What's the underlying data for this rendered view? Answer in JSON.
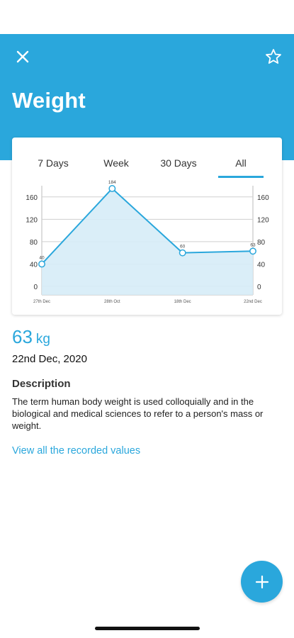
{
  "header": {
    "title": "Weight",
    "close_icon": "close-icon",
    "favorite_icon": "star-outline-icon"
  },
  "tabs": [
    {
      "label": "7 Days",
      "selected": false
    },
    {
      "label": "Week",
      "selected": false
    },
    {
      "label": "30 Days",
      "selected": false
    },
    {
      "label": "All",
      "selected": true
    }
  ],
  "chart_data": {
    "type": "area",
    "x": [
      "27th Dec",
      "28th Oct",
      "18th Dec",
      "22nd Dec"
    ],
    "y": [
      40,
      175,
      60,
      63
    ],
    "data_labels": [
      "40",
      "184",
      "60",
      "63"
    ],
    "yticks_left": [
      0,
      40,
      80,
      120,
      160
    ],
    "yticks_right": [
      0,
      40,
      80,
      120,
      160
    ],
    "ylim": [
      0,
      180
    ],
    "grid": true,
    "colors": {
      "line": "#2aa7dc",
      "fill": "#d6ecf7"
    }
  },
  "latest": {
    "value": "63",
    "unit": "kg",
    "date": "22nd Dec, 2020"
  },
  "description": {
    "title": "Description",
    "text": "The term human body weight is used colloquially and in the biological and medical sciences to refer to a person's mass or weight."
  },
  "link": {
    "label": "View all the recorded values"
  },
  "fab": {
    "icon": "plus-icon"
  },
  "colors": {
    "accent": "#2aa7dc"
  }
}
